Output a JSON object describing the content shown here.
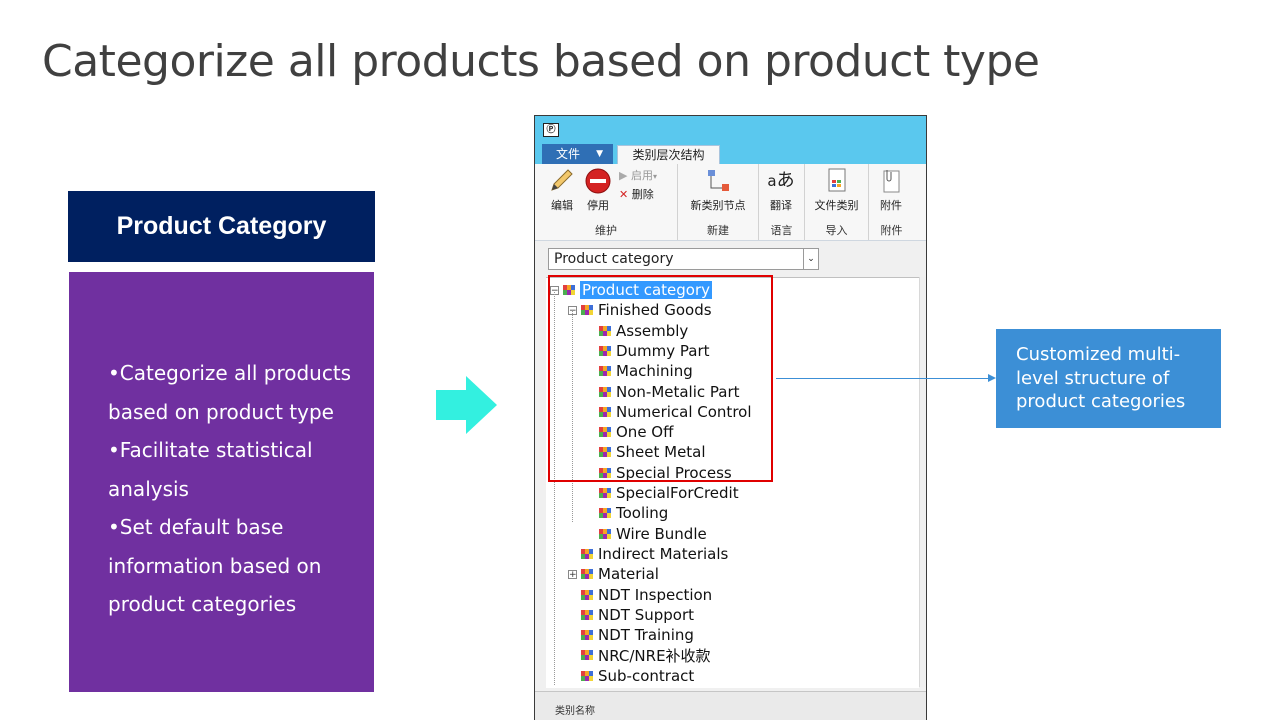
{
  "slide": {
    "title": "Categorize all products based on product type"
  },
  "category_panel": {
    "header": "Product Category",
    "bullets": [
      "•Categorize all products",
      "based on product type",
      "•Facilitate statistical",
      "analysis",
      "•Set default base",
      "information based on",
      "product categories"
    ]
  },
  "app": {
    "file_tab": "文件",
    "active_tab": "类别层次结构",
    "ribbon": {
      "groups": [
        {
          "label": "维护",
          "buttons": [
            "编辑",
            "停用",
            "启用",
            "删除"
          ]
        },
        {
          "label": "新建",
          "buttons": [
            "新类别节点"
          ]
        },
        {
          "label": "语言",
          "buttons": [
            "翻译"
          ]
        },
        {
          "label": "导入",
          "buttons": [
            "文件类别"
          ]
        },
        {
          "label": "附件",
          "buttons": [
            "附件"
          ]
        }
      ]
    },
    "combo_value": "Product category",
    "tree": [
      {
        "label": "Product category",
        "level": 0,
        "selected": true,
        "expander": "⊟"
      },
      {
        "label": "Finished Goods",
        "level": 1,
        "expander": "⊟"
      },
      {
        "label": "Assembly",
        "level": 2
      },
      {
        "label": "Dummy Part",
        "level": 2
      },
      {
        "label": "Machining",
        "level": 2
      },
      {
        "label": "Non-Metalic Part",
        "level": 2
      },
      {
        "label": "Numerical Control",
        "level": 2
      },
      {
        "label": "One Off",
        "level": 2
      },
      {
        "label": "Sheet Metal",
        "level": 2
      },
      {
        "label": "Special Process",
        "level": 2
      },
      {
        "label": "SpecialForCredit",
        "level": 2
      },
      {
        "label": "Tooling",
        "level": 2
      },
      {
        "label": "Wire Bundle",
        "level": 2
      },
      {
        "label": "Indirect  Materials",
        "level": 1
      },
      {
        "label": "Material",
        "level": 1,
        "expander": "⊞"
      },
      {
        "label": "NDT Inspection",
        "level": 1
      },
      {
        "label": "NDT Support",
        "level": 1
      },
      {
        "label": "NDT Training",
        "level": 1
      },
      {
        "label": "NRC/NRE补收款",
        "level": 1
      },
      {
        "label": "Sub-contract",
        "level": 1
      }
    ],
    "status_label": "类别名称"
  },
  "callout": {
    "lines": [
      "Customized multi-",
      "level structure of",
      "product categories"
    ]
  },
  "colors": {
    "header_navy": "#002060",
    "panel_purple": "#7030a0",
    "arrow_cyan": "#33f0e0",
    "callout_blue": "#3c8fd6",
    "highlight_red": "#e00000",
    "titlebar": "#5ac8ee"
  }
}
